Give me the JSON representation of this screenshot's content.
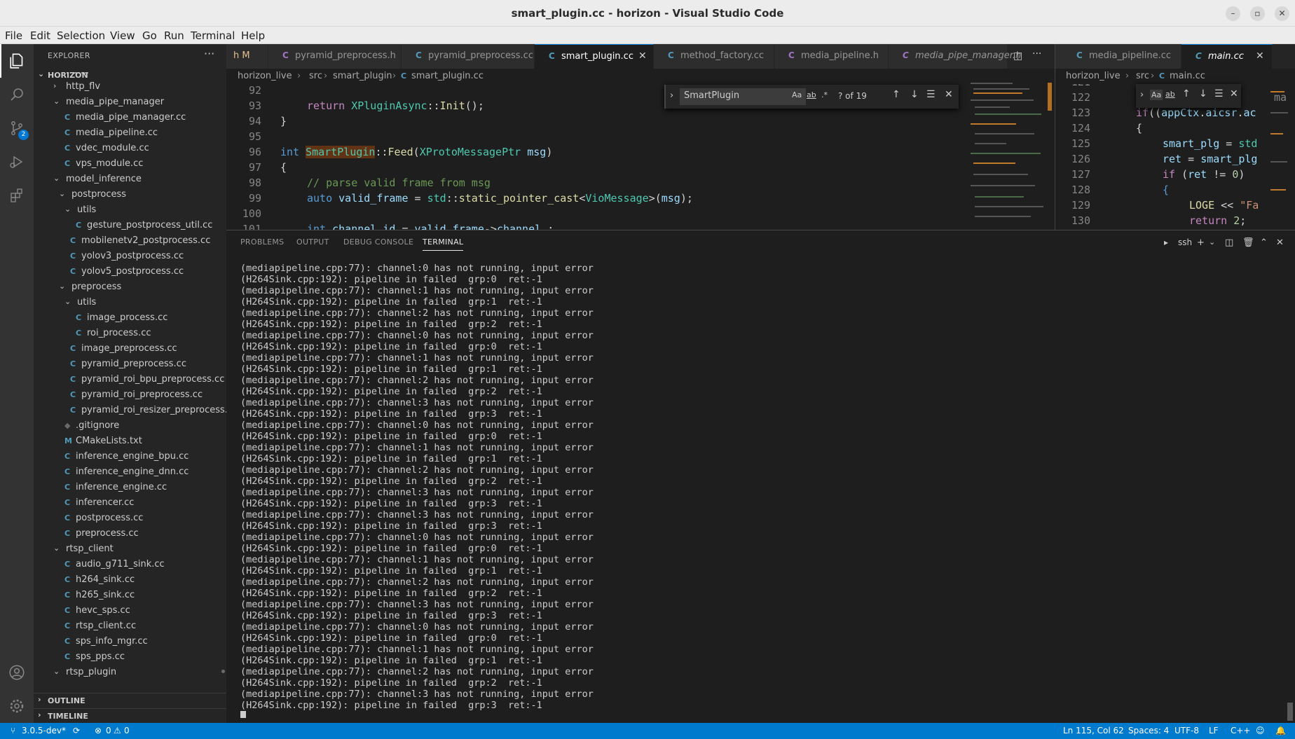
{
  "window": {
    "title": "smart_plugin.cc - horizon - Visual Studio Code",
    "minimize": "–",
    "restore": "▫",
    "close": "✕"
  },
  "menu": [
    "File",
    "Edit",
    "Selection",
    "View",
    "Go",
    "Run",
    "Terminal",
    "Help"
  ],
  "activity": {
    "scm_badge": "2"
  },
  "sidebar": {
    "header": "EXPLORER",
    "more": "···",
    "root": "HORIZON",
    "outline": "OUTLINE",
    "timeline": "TIMELINE",
    "tree": [
      {
        "label": "hdmi",
        "type": "folder",
        "open": false
      },
      {
        "label": "http_flv",
        "type": "folder",
        "open": false
      },
      {
        "label": "media_pipe_manager",
        "type": "folder",
        "open": true
      },
      {
        "label": "media_pipe_manager.cc",
        "type": "file",
        "icon": "C"
      },
      {
        "label": "media_pipeline.cc",
        "type": "file",
        "icon": "C"
      },
      {
        "label": "vdec_module.cc",
        "type": "file",
        "icon": "C"
      },
      {
        "label": "vps_module.cc",
        "type": "file",
        "icon": "C"
      },
      {
        "label": "model_inference",
        "type": "folder",
        "open": true
      },
      {
        "label": "postprocess",
        "type": "folder",
        "open": true
      },
      {
        "label": "utils",
        "type": "folder",
        "open": true
      },
      {
        "label": "gesture_postprocess_util.cc",
        "type": "file",
        "icon": "C"
      },
      {
        "label": "mobilenetv2_postprocess.cc",
        "type": "file",
        "icon": "C"
      },
      {
        "label": "yolov3_postprocess.cc",
        "type": "file",
        "icon": "C"
      },
      {
        "label": "yolov5_postprocess.cc",
        "type": "file",
        "icon": "C"
      },
      {
        "label": "preprocess",
        "type": "folder",
        "open": true
      },
      {
        "label": "utils",
        "type": "folder",
        "open": true
      },
      {
        "label": "image_process.cc",
        "type": "file",
        "icon": "C"
      },
      {
        "label": "roi_process.cc",
        "type": "file",
        "icon": "C"
      },
      {
        "label": "image_preprocess.cc",
        "type": "file",
        "icon": "C"
      },
      {
        "label": "pyramid_preprocess.cc",
        "type": "file",
        "icon": "C"
      },
      {
        "label": "pyramid_roi_bpu_preprocess.cc",
        "type": "file",
        "icon": "C"
      },
      {
        "label": "pyramid_roi_preprocess.cc",
        "type": "file",
        "icon": "C"
      },
      {
        "label": "pyramid_roi_resizer_preprocess.cc",
        "type": "file",
        "icon": "C"
      },
      {
        "label": ".gitignore",
        "type": "file",
        "icon": "◆"
      },
      {
        "label": "CMakeLists.txt",
        "type": "file",
        "icon": "M"
      },
      {
        "label": "inference_engine_bpu.cc",
        "type": "file",
        "icon": "C"
      },
      {
        "label": "inference_engine_dnn.cc",
        "type": "file",
        "icon": "C"
      },
      {
        "label": "inference_engine.cc",
        "type": "file",
        "icon": "C"
      },
      {
        "label": "inferencer.cc",
        "type": "file",
        "icon": "C"
      },
      {
        "label": "postprocess.cc",
        "type": "file",
        "icon": "C"
      },
      {
        "label": "preprocess.cc",
        "type": "file",
        "icon": "C"
      },
      {
        "label": "rtsp_client",
        "type": "folder",
        "open": true
      },
      {
        "label": "audio_g711_sink.cc",
        "type": "file",
        "icon": "C"
      },
      {
        "label": "h264_sink.cc",
        "type": "file",
        "icon": "C"
      },
      {
        "label": "h265_sink.cc",
        "type": "file",
        "icon": "C"
      },
      {
        "label": "hevc_sps.cc",
        "type": "file",
        "icon": "C"
      },
      {
        "label": "rtsp_client.cc",
        "type": "file",
        "icon": "C"
      },
      {
        "label": "sps_info_mgr.cc",
        "type": "file",
        "icon": "C"
      },
      {
        "label": "sps_pps.cc",
        "type": "file",
        "icon": "C"
      },
      {
        "label": "rtsp_plugin",
        "type": "folder",
        "open": true
      }
    ]
  },
  "editor": {
    "tabs": [
      {
        "label": "h M",
        "icon": ""
      },
      {
        "label": "pyramid_preprocess.h",
        "icon": "C"
      },
      {
        "label": "pyramid_preprocess.cc",
        "icon": "C"
      },
      {
        "label": "smart_plugin.cc",
        "icon": "C",
        "active": true,
        "close": "✕"
      },
      {
        "label": "method_factory.cc",
        "icon": "C"
      },
      {
        "label": "media_pipeline.h",
        "icon": "C"
      },
      {
        "label": "media_pipe_manager.h",
        "icon": "C"
      }
    ],
    "breadcrumb": [
      "horizon_live",
      "src",
      "smart_plugin",
      "smart_plugin.cc"
    ],
    "find": {
      "query": "SmartPlugin",
      "case": "Aa",
      "word": "ab",
      "regex": ".*",
      "count": "? of 19"
    },
    "line_numbers": [
      "92",
      "93",
      "94",
      "95",
      "96",
      "97",
      "98",
      "99",
      "100",
      "101"
    ],
    "code": {
      "l93": [
        "return ",
        "XPluginAsync",
        "::",
        "Init",
        "();"
      ],
      "l94": "}",
      "l96": [
        "int ",
        "SmartPlugin",
        "::",
        "Feed",
        "(",
        "XProtoMessagePtr",
        " ",
        "msg",
        ")"
      ],
      "l97": "{",
      "l98": "// parse valid frame from msg",
      "l99": [
        "auto ",
        "valid_frame",
        " = ",
        "std",
        "::",
        "static_pointer_cast",
        "<",
        "VioMessage",
        ">(",
        "msg",
        ");"
      ],
      "l101": [
        "int ",
        "channel_id",
        " = ",
        "valid_frame",
        "->",
        "channel_",
        ";"
      ]
    }
  },
  "editor2": {
    "tabs": [
      {
        "label": "media_pipeline.cc",
        "icon": "C"
      },
      {
        "label": "main.cc",
        "icon": "C",
        "close": "✕"
      }
    ],
    "breadcrumb": [
      "horizon_live",
      "src",
      "main.cc"
    ],
    "find": {
      "case": "Aa",
      "word": "ab"
    },
    "line_numbers": [
      "121",
      "122",
      "123",
      "124",
      "125",
      "126",
      "127",
      "128",
      "129",
      "130"
    ],
    "code": {
      "l122": "ma",
      "l123": [
        "if",
        "((",
        "appCtx",
        ".",
        "aicsr",
        ".",
        "ac"
      ],
      "l124": "{",
      "l125": [
        "smart_plg",
        " = ",
        "std"
      ],
      "l126": [
        "ret",
        " = ",
        "smart_plg"
      ],
      "l127": [
        "if",
        " (",
        "ret",
        " != ",
        "0",
        ")"
      ],
      "l128": "{",
      "l129": [
        "LOGE",
        " << ",
        "\"Fa"
      ],
      "l130": [
        "return ",
        "2",
        ";"
      ]
    }
  },
  "panel": {
    "tabs": [
      "PROBLEMS",
      "OUTPUT",
      "DEBUG CONSOLE",
      "TERMINAL"
    ],
    "shell": "ssh",
    "terminal_lines": [
      "(mediapipeline.cpp:77): channel:0 has not running, input error",
      "(H264Sink.cpp:192): pipeline in failed  grp:0  ret:-1",
      "(mediapipeline.cpp:77): channel:1 has not running, input error",
      "(H264Sink.cpp:192): pipeline in failed  grp:1  ret:-1",
      "(mediapipeline.cpp:77): channel:2 has not running, input error",
      "(H264Sink.cpp:192): pipeline in failed  grp:2  ret:-1",
      "(mediapipeline.cpp:77): channel:0 has not running, input error",
      "(H264Sink.cpp:192): pipeline in failed  grp:0  ret:-1",
      "(mediapipeline.cpp:77): channel:1 has not running, input error",
      "(H264Sink.cpp:192): pipeline in failed  grp:1  ret:-1",
      "(mediapipeline.cpp:77): channel:2 has not running, input error",
      "(H264Sink.cpp:192): pipeline in failed  grp:2  ret:-1",
      "(mediapipeline.cpp:77): channel:3 has not running, input error",
      "(H264Sink.cpp:192): pipeline in failed  grp:3  ret:-1",
      "(mediapipeline.cpp:77): channel:0 has not running, input error",
      "(H264Sink.cpp:192): pipeline in failed  grp:0  ret:-1",
      "(mediapipeline.cpp:77): channel:1 has not running, input error",
      "(H264Sink.cpp:192): pipeline in failed  grp:1  ret:-1",
      "(mediapipeline.cpp:77): channel:2 has not running, input error",
      "(H264Sink.cpp:192): pipeline in failed  grp:2  ret:-1",
      "(mediapipeline.cpp:77): channel:3 has not running, input error",
      "(H264Sink.cpp:192): pipeline in failed  grp:3  ret:-1",
      "(mediapipeline.cpp:77): channel:3 has not running, input error",
      "(H264Sink.cpp:192): pipeline in failed  grp:3  ret:-1",
      "(mediapipeline.cpp:77): channel:0 has not running, input error",
      "(H264Sink.cpp:192): pipeline in failed  grp:0  ret:-1",
      "(mediapipeline.cpp:77): channel:1 has not running, input error",
      "(H264Sink.cpp:192): pipeline in failed  grp:1  ret:-1",
      "(mediapipeline.cpp:77): channel:2 has not running, input error",
      "(H264Sink.cpp:192): pipeline in failed  grp:2  ret:-1",
      "(mediapipeline.cpp:77): channel:3 has not running, input error",
      "(H264Sink.cpp:192): pipeline in failed  grp:3  ret:-1",
      "(mediapipeline.cpp:77): channel:0 has not running, input error",
      "(H264Sink.cpp:192): pipeline in failed  grp:0  ret:-1",
      "(mediapipeline.cpp:77): channel:1 has not running, input error",
      "(H264Sink.cpp:192): pipeline in failed  grp:1  ret:-1",
      "(mediapipeline.cpp:77): channel:2 has not running, input error",
      "(H264Sink.cpp:192): pipeline in failed  grp:2  ret:-1",
      "(mediapipeline.cpp:77): channel:3 has not running, input error",
      "(H264Sink.cpp:192): pipeline in failed  grp:3  ret:-1"
    ]
  },
  "status": {
    "branch": "3.0.5-dev*",
    "sync": "⟳",
    "errors": "0",
    "warnings": "0",
    "position": "Ln 115, Col 62",
    "spaces": "Spaces: 4",
    "encoding": "UTF-8",
    "eol": "LF",
    "language": "C++"
  },
  "colors": {
    "accent": "#007acc",
    "sidebar_bg": "#252526",
    "editor_bg": "#1e1e1e",
    "titlebar_bg": "#ececec",
    "active_tab_border": "#0078d4",
    "find_highlight": "#613214"
  }
}
